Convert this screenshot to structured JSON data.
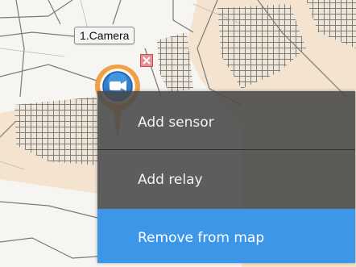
{
  "camera_marker": {
    "label": "1.Camera",
    "icon": "video-camera-icon",
    "ring_color": "#e8831e",
    "badge_color": "#2f7fd0"
  },
  "context_menu": {
    "items": [
      {
        "label": "Add sensor"
      },
      {
        "label": "Add relay"
      },
      {
        "label": "Remove from map",
        "highlighted": true,
        "highlight_color": "#3d97e9"
      }
    ]
  },
  "map": {
    "background_color": "#f6f5f1",
    "area_color": "#f4e4cf",
    "hatch_color": "#6b6b6b"
  }
}
